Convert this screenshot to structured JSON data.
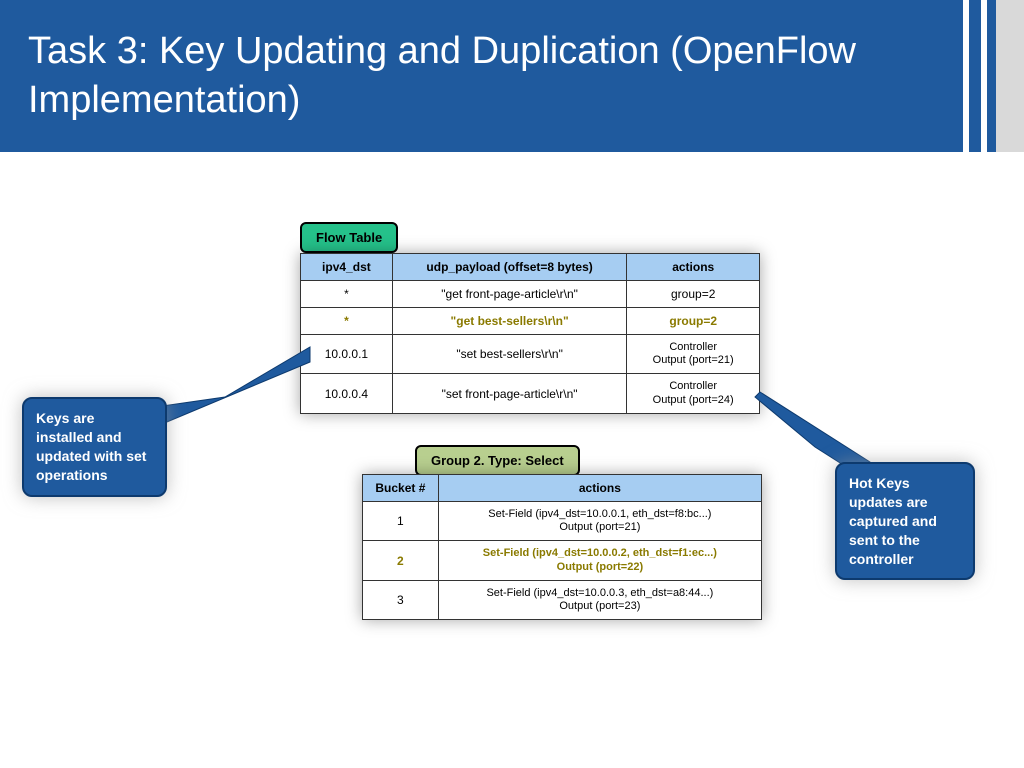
{
  "title": "Task 3: Key Updating and Duplication (OpenFlow Implementation)",
  "flow_badge": "Flow Table",
  "group_badge": "Group 2. Type: Select",
  "flow": {
    "headers": [
      "ipv4_dst",
      "udp_payload (offset=8 bytes)",
      "actions"
    ],
    "rows": [
      {
        "c0": "*",
        "c1": "\"get front-page-article\\r\\n\"",
        "c2": "group=2",
        "hl": false
      },
      {
        "c0": "*",
        "c1": "\"get best-sellers\\r\\n\"",
        "c2": "group=2",
        "hl": true
      },
      {
        "c0": "10.0.0.1",
        "c1": "\"set best-sellers\\r\\n\"",
        "c2": "Controller\nOutput (port=21)",
        "hl": false
      },
      {
        "c0": "10.0.0.4",
        "c1": "\"set front-page-article\\r\\n\"",
        "c2": "Controller\nOutput (port=24)",
        "hl": false
      }
    ]
  },
  "group": {
    "headers": [
      "Bucket #",
      "actions"
    ],
    "rows": [
      {
        "c0": "1",
        "c1": "Set-Field (ipv4_dst=10.0.0.1, eth_dst=f8:bc...)\nOutput (port=21)",
        "hl": false
      },
      {
        "c0": "2",
        "c1": "Set-Field (ipv4_dst=10.0.0.2, eth_dst=f1:ec...)\nOutput (port=22)",
        "hl": true
      },
      {
        "c0": "3",
        "c1": "Set-Field (ipv4_dst=10.0.0.3, eth_dst=a8:44...)\nOutput (port=23)",
        "hl": false
      }
    ]
  },
  "callout_left": "Keys are installed and updated with set operations",
  "callout_right": "Hot Keys updates are captured and sent to the controller"
}
